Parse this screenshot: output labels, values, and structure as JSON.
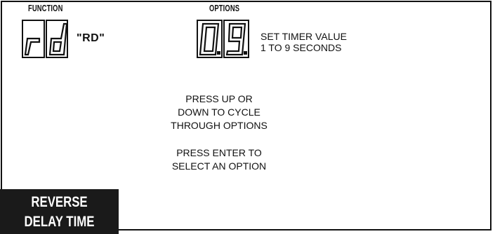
{
  "headers": {
    "function": "FUNCTION",
    "options": "OPTIONS"
  },
  "function_display": {
    "digits": [
      "r",
      "d"
    ],
    "label": "\"RD\""
  },
  "options_display": {
    "digits": [
      "0.",
      "9."
    ],
    "description_line1": "SET TIMER VALUE",
    "description_line2": "1 TO 9 SECONDS"
  },
  "instructions": {
    "cycle_line1": "PRESS UP OR",
    "cycle_line2": "DOWN TO CYCLE",
    "cycle_line3": "THROUGH OPTIONS",
    "select_line1": "PRESS ENTER TO",
    "select_line2": "SELECT AN OPTION"
  },
  "tab": {
    "line1": "REVERSE",
    "line2": "DELAY TIME"
  },
  "colors": {
    "ink": "#111111",
    "tab_background": "#1a1a1a",
    "tab_text": "#ffffff"
  }
}
